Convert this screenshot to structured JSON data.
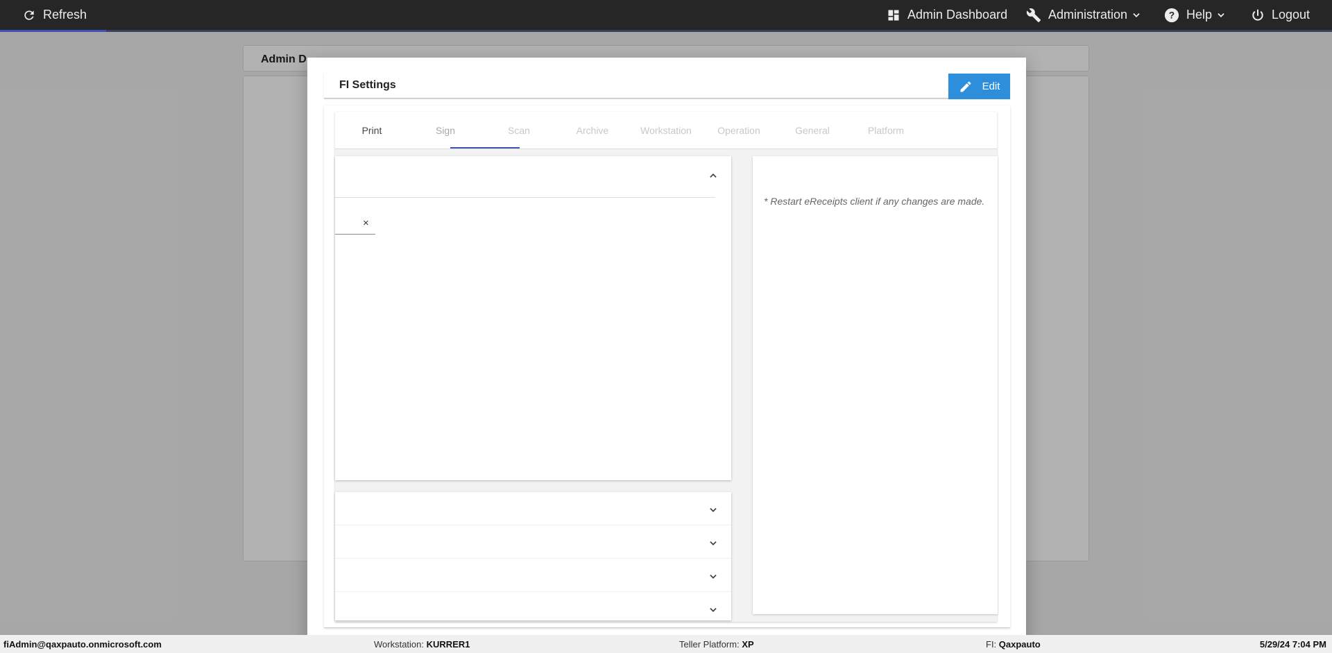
{
  "topbar": {
    "refresh": "Refresh",
    "admin_dashboard": "Admin Dashboard",
    "administration": "Administration",
    "help": "Help",
    "logout": "Logout"
  },
  "background": {
    "header_text": "Admin D"
  },
  "modal": {
    "title": "FI Settings",
    "edit_label": "Edit",
    "tabs": [
      "Print",
      "Sign",
      "Scan",
      "Archive",
      "Workstation",
      "Operation",
      "General",
      "Platform"
    ],
    "active_tab": "Print",
    "field_clear": "×",
    "note": "* Restart eReceipts client if any changes are made."
  },
  "footer": {
    "user": "fiAdmin@qaxpauto.onmicrosoft.com",
    "workstation_label": "Workstation:",
    "workstation_value": "KURRER1",
    "platform_label": "Teller Platform:",
    "platform_value": "XP",
    "fi_label": "FI:",
    "fi_value": "Qaxpauto",
    "datetime": "5/29/24 7:04 PM"
  },
  "colors": {
    "topbar": "#262626",
    "accent": "#3f51b5",
    "edit_button": "#2d8fdc"
  }
}
